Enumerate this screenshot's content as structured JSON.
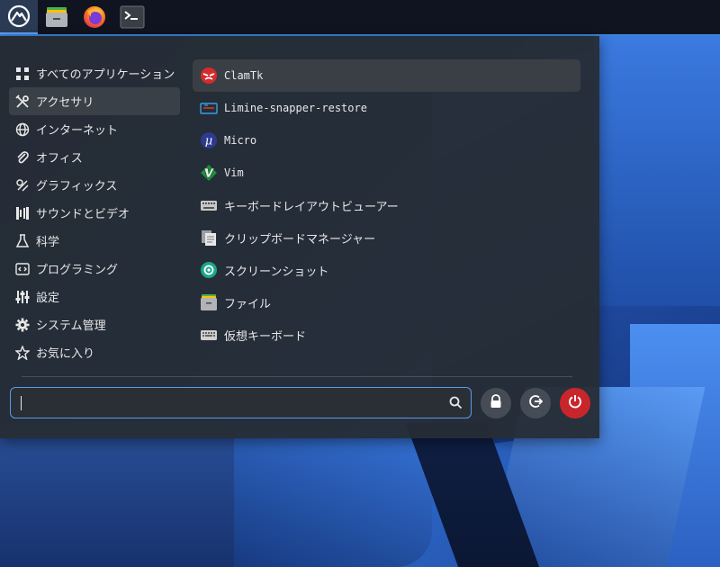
{
  "taskbar": {
    "items": [
      {
        "icon": "distro-logo-icon"
      },
      {
        "icon": "file-manager-icon"
      },
      {
        "icon": "firefox-icon"
      },
      {
        "icon": "terminal-icon"
      }
    ]
  },
  "categories": [
    {
      "label": "すべてのアプリケーション",
      "icon": "grid-icon"
    },
    {
      "label": "アクセサリ",
      "icon": "tools-icon"
    },
    {
      "label": "インターネット",
      "icon": "globe-icon"
    },
    {
      "label": "オフィス",
      "icon": "paperclip-icon"
    },
    {
      "label": "グラフィックス",
      "icon": "palette-icon"
    },
    {
      "label": "サウンドとビデオ",
      "icon": "film-icon"
    },
    {
      "label": "科学",
      "icon": "flask-icon"
    },
    {
      "label": "プログラミング",
      "icon": "code-icon"
    },
    {
      "label": "設定",
      "icon": "sliders-icon"
    },
    {
      "label": "システム管理",
      "icon": "gear-icon"
    },
    {
      "label": "お気に入り",
      "icon": "star-icon"
    }
  ],
  "apps": [
    {
      "label": "ClamTk",
      "icon": "clamtk-icon"
    },
    {
      "label": "Limine-snapper-restore",
      "icon": "snapper-icon"
    },
    {
      "label": "Micro",
      "icon": "micro-icon"
    },
    {
      "label": "Vim",
      "icon": "vim-icon"
    },
    {
      "label": "キーボードレイアウトビューアー",
      "icon": "keyboard-icon"
    },
    {
      "label": "クリップボードマネージャー",
      "icon": "clipboard-icon"
    },
    {
      "label": "スクリーンショット",
      "icon": "screenshot-icon"
    },
    {
      "label": "ファイル",
      "icon": "files-icon"
    },
    {
      "label": "仮想キーボード",
      "icon": "virtual-keyboard-icon"
    }
  ],
  "search": {
    "value": "",
    "placeholder": ""
  },
  "colors": {
    "accent": "#5a9ae6",
    "power": "#c9262c",
    "panel": "#262c34"
  }
}
